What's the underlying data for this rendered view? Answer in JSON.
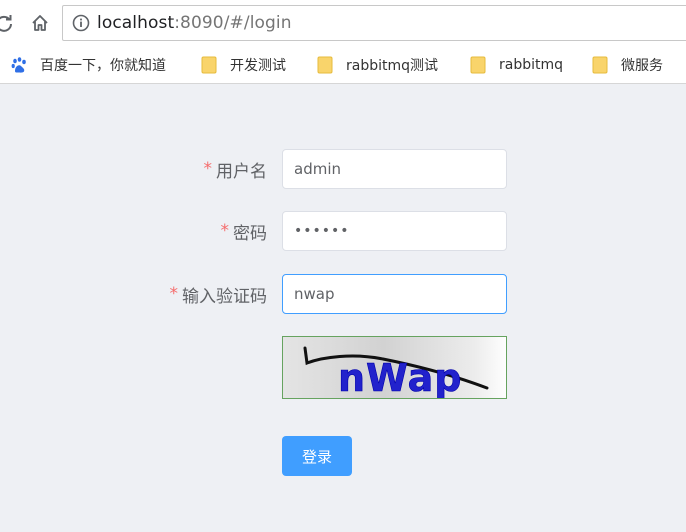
{
  "browser": {
    "url_host": "localhost",
    "url_path": ":8090/#/login",
    "bookmarks": [
      {
        "label": "百度一下，你就知道",
        "icon": "baidu-paw-icon"
      },
      {
        "label": "开发测试",
        "icon": "folder-icon"
      },
      {
        "label": "rabbitmq测试",
        "icon": "folder-icon"
      },
      {
        "label": "rabbitmq",
        "icon": "folder-icon"
      },
      {
        "label": "微服务",
        "icon": "folder-icon"
      }
    ]
  },
  "form": {
    "required_mark": "*",
    "username": {
      "label": "用户名",
      "value": "admin"
    },
    "password": {
      "label": "密码",
      "value": "••••••"
    },
    "captcha": {
      "label": "输入验证码",
      "value": "nwap",
      "image_text": "nWap"
    },
    "submit_label": "登录"
  },
  "colors": {
    "primary": "#409eff",
    "required": "#f56c6c",
    "page_bg": "#eef0f4",
    "captcha_border": "#66a35f"
  }
}
